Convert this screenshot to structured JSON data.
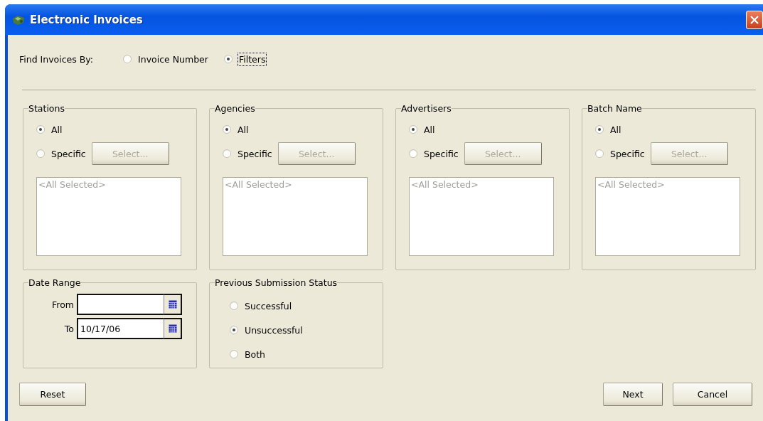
{
  "window": {
    "title": "Electronic Invoices"
  },
  "find_by": {
    "label": "Find Invoices By:",
    "options": [
      {
        "label": "Invoice Number",
        "selected": false,
        "focused": false
      },
      {
        "label": "Filters",
        "selected": true,
        "focused": true
      }
    ]
  },
  "filters": [
    {
      "title": "Stations",
      "options": [
        {
          "label": "All",
          "selected": true
        },
        {
          "label": "Specific",
          "selected": false
        }
      ],
      "select_button": {
        "label": "Select...",
        "disabled": true
      },
      "list_text": "<All Selected>"
    },
    {
      "title": "Agencies",
      "options": [
        {
          "label": "All",
          "selected": true
        },
        {
          "label": "Specific",
          "selected": false
        }
      ],
      "select_button": {
        "label": "Select...",
        "disabled": true
      },
      "list_text": "<All Selected>"
    },
    {
      "title": "Advertisers",
      "options": [
        {
          "label": "All",
          "selected": true
        },
        {
          "label": "Specific",
          "selected": false
        }
      ],
      "select_button": {
        "label": "Select...",
        "disabled": true
      },
      "list_text": "<All Selected>"
    },
    {
      "title": "Batch Name",
      "options": [
        {
          "label": "All",
          "selected": true
        },
        {
          "label": "Specific",
          "selected": false
        }
      ],
      "select_button": {
        "label": "Select...",
        "disabled": true
      },
      "list_text": "<All Selected>"
    }
  ],
  "date_range": {
    "title": "Date Range",
    "fields": [
      {
        "label": "From"
      },
      {
        "label": "To",
        "value": "10/17/06"
      }
    ]
  },
  "submission_status": {
    "title": "Previous Submission Status",
    "options": [
      {
        "label": "Successful",
        "selected": false
      },
      {
        "label": "Unsuccessful",
        "selected": true
      },
      {
        "label": "Both",
        "selected": false
      }
    ]
  },
  "left_buttons": [
    "Reset"
  ],
  "right_buttons": [
    "Next",
    "Cancel"
  ]
}
